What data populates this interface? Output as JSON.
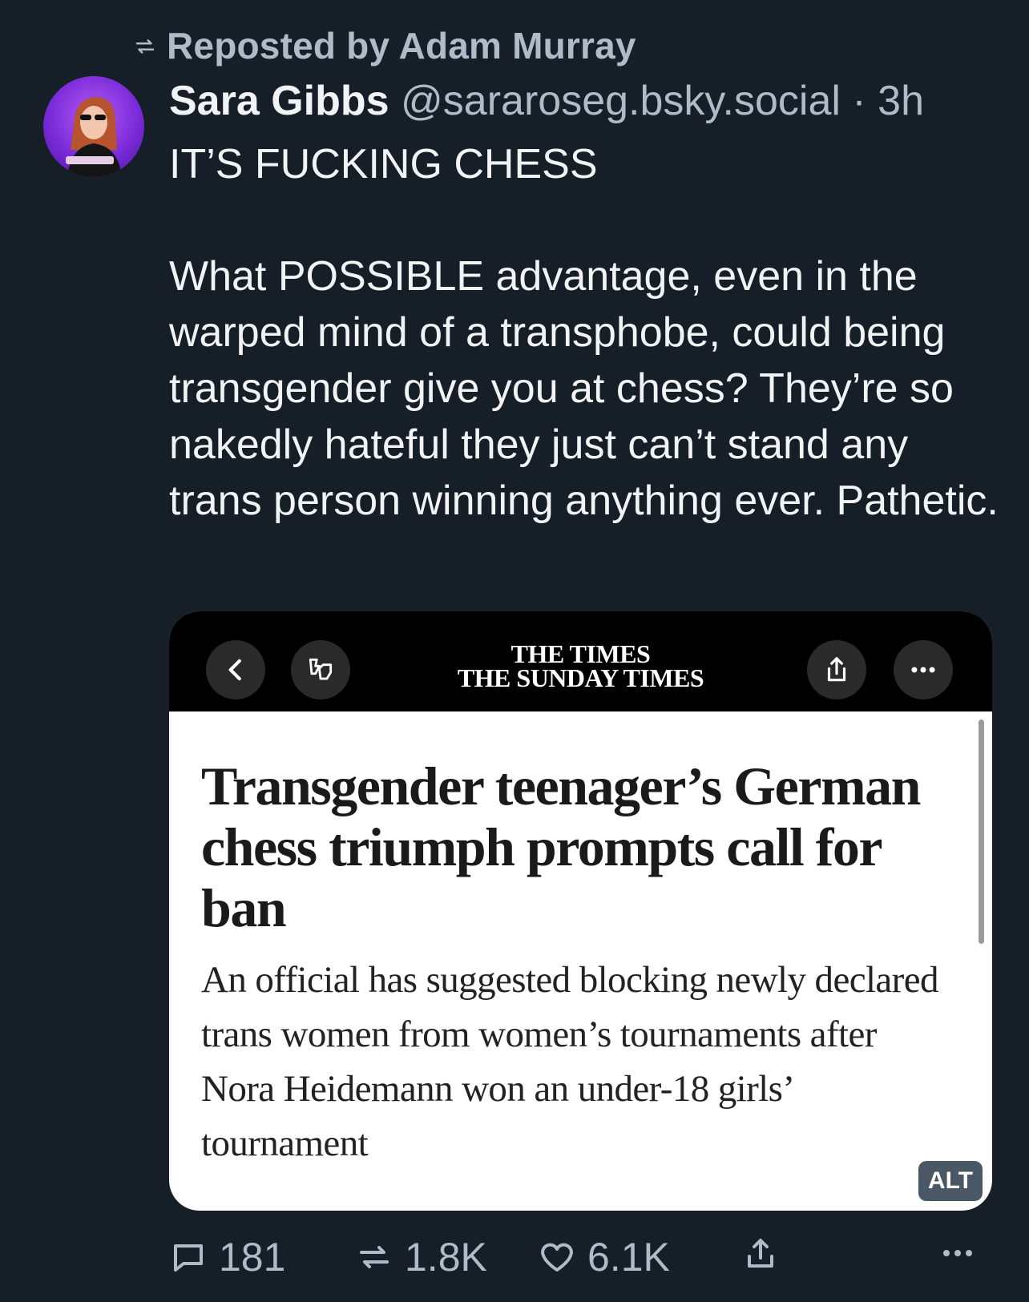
{
  "repost": {
    "icon": "repost-icon",
    "label": "Reposted by Adam Murray"
  },
  "post": {
    "author": "Sara Gibbs",
    "handle": "@sararoseg.bsky.social",
    "separator": "·",
    "time": "3h",
    "text_line1": "IT’S FUCKING CHESS",
    "text_body": "What POSSIBLE advantage, even in the warped mind of a transphobe, could being transgender give you at chess? They’re so nakedly hateful they just can’t stand any trans person winning anything ever. Pathetic."
  },
  "embed": {
    "masthead_line1": "THE TIMES",
    "masthead_line2": "THE SUNDAY TIMES",
    "headline": "Transgender teenager’s German chess triumph prompts call for ban",
    "standfirst": "An official has suggested blocking newly declared trans women from women’s tournaments after Nora Heidemann won an under-18 girls’ tournament",
    "alt_label": "ALT"
  },
  "actions": {
    "replies": "181",
    "reposts": "1.8K",
    "likes": "6.1K"
  },
  "colors": {
    "background": "#161e27",
    "muted_text": "#aebbc9",
    "primary_text": "#f1f3f5",
    "avatar_purple": "#7b2bd9"
  }
}
